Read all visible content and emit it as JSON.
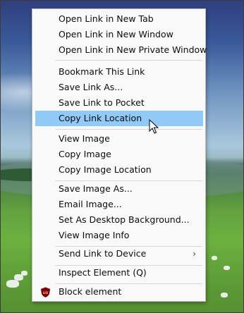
{
  "menu": {
    "items": [
      {
        "label": "Open Link in New Tab"
      },
      {
        "label": "Open Link in New Window"
      },
      {
        "label": "Open Link in New Private Window"
      },
      {
        "label": "Bookmark This Link"
      },
      {
        "label": "Save Link As..."
      },
      {
        "label": "Save Link to Pocket"
      },
      {
        "label": "Copy Link Location",
        "highlighted": true
      },
      {
        "label": "View Image"
      },
      {
        "label": "Copy Image"
      },
      {
        "label": "Copy Image Location"
      },
      {
        "label": "Save Image As..."
      },
      {
        "label": "Email Image..."
      },
      {
        "label": "Set As Desktop Background..."
      },
      {
        "label": "View Image Info"
      },
      {
        "label": "Send Link to Device",
        "submenu_arrow": "›"
      },
      {
        "label": "Inspect Element (Q)"
      },
      {
        "label": "Block element",
        "icon": "ublock-origin-icon"
      }
    ]
  },
  "colors": {
    "highlight": "#91c9f7",
    "menu_background": "#f9f9fa",
    "ublock_red": "#800000"
  }
}
